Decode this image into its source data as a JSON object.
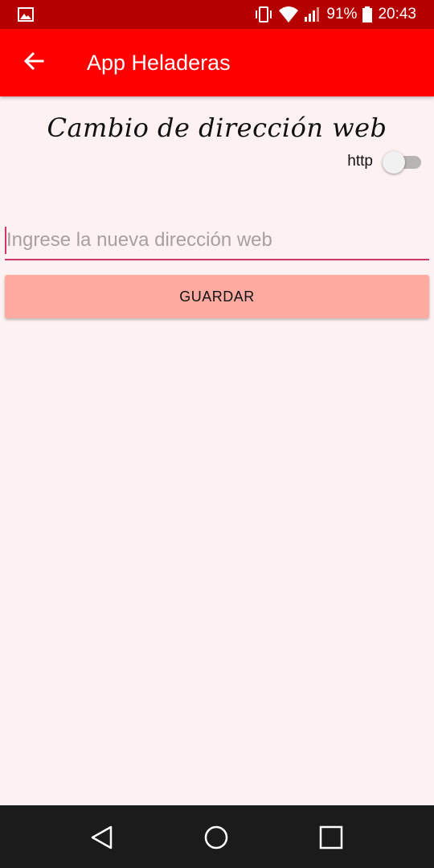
{
  "status_bar": {
    "battery_percent": "91%",
    "time": "20:43",
    "icons": [
      "image-icon",
      "vibrate-icon",
      "wifi-icon",
      "signal-icon",
      "battery-icon"
    ]
  },
  "app_bar": {
    "title": "App Heladeras",
    "back_icon": "arrow-left-icon",
    "color": "#ff0000"
  },
  "main": {
    "heading": "Cambio de dirección web",
    "toggle": {
      "label": "http",
      "checked": false
    },
    "url_input": {
      "value": "",
      "placeholder": "Ingrese la nueva dirección web"
    },
    "save_label": "GUARDAR",
    "save_color": "#ffaba1"
  },
  "nav_bar": {
    "buttons": [
      "back-triangle-icon",
      "home-circle-icon",
      "recents-square-icon"
    ]
  }
}
